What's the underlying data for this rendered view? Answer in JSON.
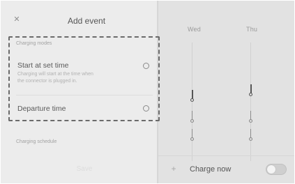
{
  "dialog": {
    "title": "Add event",
    "close_icon": "close-icon",
    "charging_modes_label": "Charging modes",
    "options": [
      {
        "title": "Start at set time",
        "description_line1": "Charging will start at the time when",
        "description_line2": "the connector is plugged in.",
        "selected": false
      },
      {
        "title": "Departure time",
        "selected": false
      }
    ],
    "charging_schedule_label": "Charging schedule",
    "footer_button": "Save"
  },
  "schedule": {
    "days": [
      "Wed",
      "Thu"
    ],
    "charge_now_label": "Charge now",
    "charge_now_enabled": false,
    "plus_icon": "plus-icon"
  }
}
